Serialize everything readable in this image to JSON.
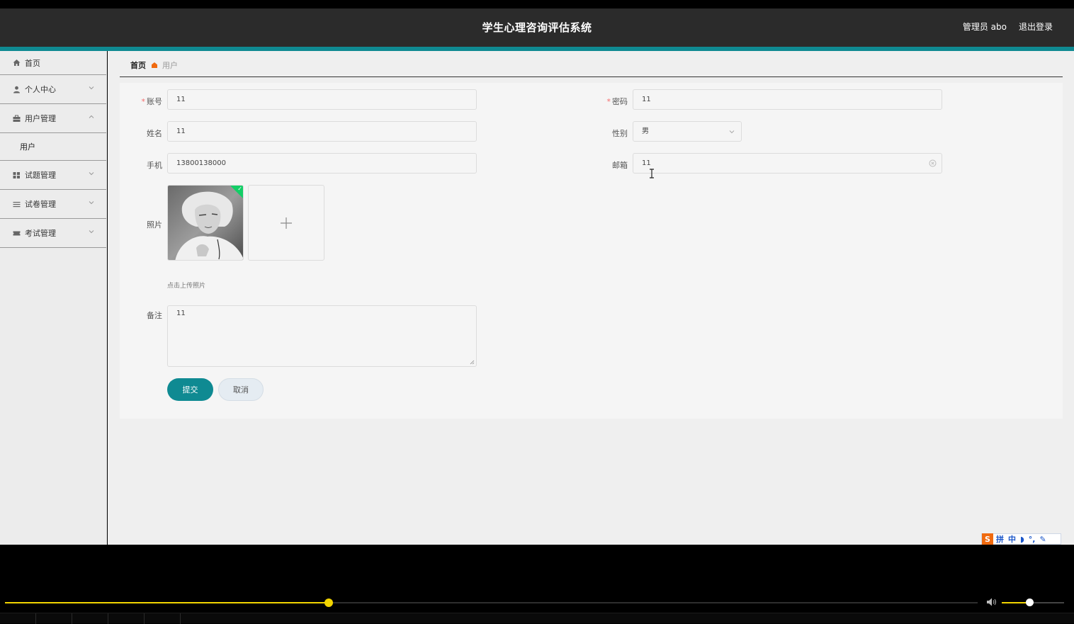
{
  "header": {
    "title": "学生心理咨询评估系统",
    "user_label": "管理员 abo",
    "logout_label": "退出登录"
  },
  "sidebar": {
    "items": [
      {
        "label": "首页",
        "icon": "home-icon"
      },
      {
        "label": "个人中心",
        "icon": "user-icon"
      },
      {
        "label": "用户管理",
        "icon": "briefcase-icon",
        "expanded": true,
        "children": [
          {
            "label": "用户"
          }
        ]
      },
      {
        "label": "试题管理",
        "icon": "grid-icon"
      },
      {
        "label": "试卷管理",
        "icon": "list-icon"
      },
      {
        "label": "考试管理",
        "icon": "ticket-icon"
      }
    ]
  },
  "breadcrumb": {
    "home": "首页",
    "current": "用户"
  },
  "form": {
    "account": {
      "label": "账号",
      "value": "11",
      "required": true
    },
    "password": {
      "label": "密码",
      "value": "11",
      "required": true
    },
    "name": {
      "label": "姓名",
      "value": "11"
    },
    "gender": {
      "label": "性别",
      "value": "男"
    },
    "phone": {
      "label": "手机",
      "value": "13800138000"
    },
    "email": {
      "label": "邮箱",
      "value": "11"
    },
    "photo": {
      "label": "照片",
      "hint": "点击上传照片"
    },
    "remark": {
      "label": "备注",
      "value": "11"
    },
    "submit_label": "提交",
    "cancel_label": "取消"
  },
  "ime": {
    "logo": "S",
    "items": [
      "拼",
      "中",
      "◗",
      "°,",
      "✎"
    ]
  },
  "player": {
    "progress": 0.3325,
    "volume": 0.44
  },
  "colors": {
    "accent": "#0f8a92",
    "header_bg": "#2b2b2b",
    "breadcrumb_marker": "#f06a0f",
    "player_progress": "#f2d400"
  }
}
